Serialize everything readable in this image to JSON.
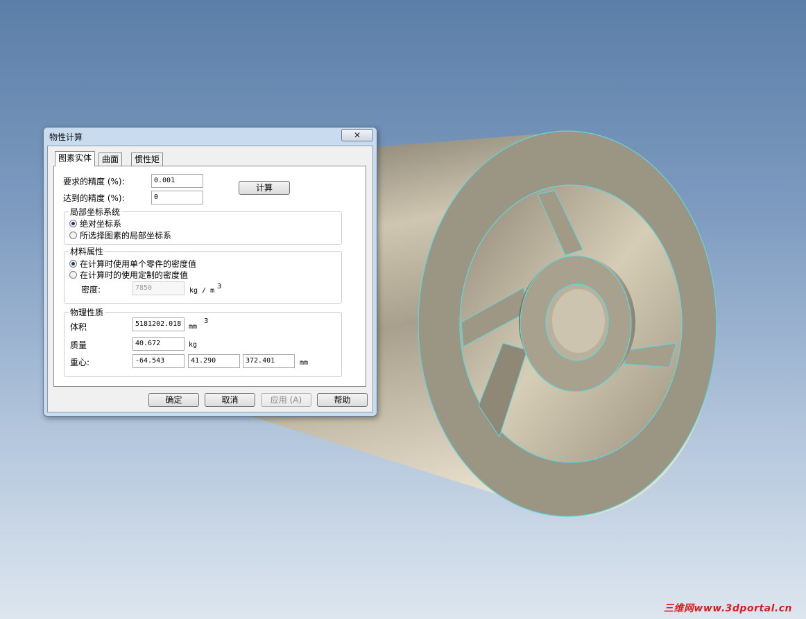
{
  "dialog": {
    "title": "物性计算",
    "close_glyph": "✕",
    "tabs": [
      "图素实体",
      "曲面",
      "惯性矩"
    ]
  },
  "precision": {
    "required_label": "要求的精度 (%):",
    "required_value": "0.001",
    "achieved_label": "达到的精度 (%):",
    "achieved_value": "0",
    "calculate_button": "计算"
  },
  "coordinate_system": {
    "legend": "局部坐标系统",
    "options": [
      "绝对坐标系",
      "所选择图素的局部坐标系"
    ],
    "selected": 0
  },
  "material": {
    "legend": "材料属性",
    "options": [
      "在计算时使用单个零件的密度值",
      "在计算时的使用定制的密度值"
    ],
    "selected": 0,
    "density_label": "密度:",
    "density_value": "7850",
    "density_unit": "kg / m",
    "density_unit_exp": "3"
  },
  "physical": {
    "legend": "物理性质",
    "volume_label": "体积",
    "volume_value": "5181202.018",
    "volume_unit": "mm",
    "volume_unit_exp": "3",
    "mass_label": "质量",
    "mass_value": "40.672",
    "mass_unit": "kg",
    "center_label": "重心:",
    "center_x": "-64.543",
    "center_y": "41.290",
    "center_z": "372.401",
    "center_unit": "mm"
  },
  "buttons": {
    "ok": "确定",
    "cancel": "取消",
    "apply": "应用 (A)",
    "help": "帮助"
  },
  "watermark": "三维网www.3dportal.cn"
}
